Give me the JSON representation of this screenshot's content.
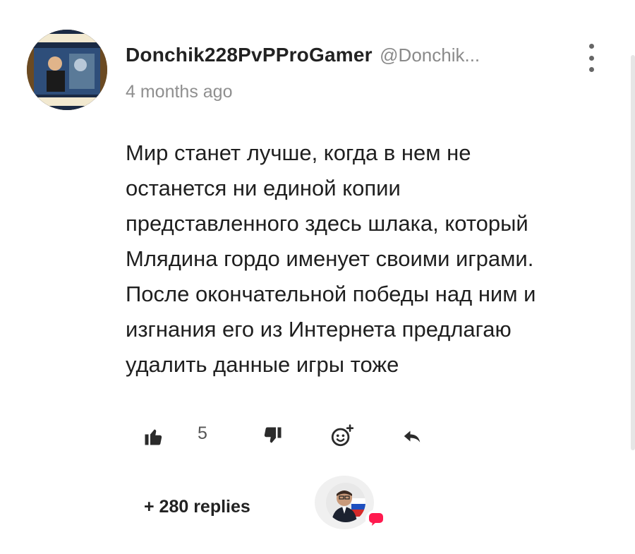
{
  "comment": {
    "author": {
      "display_name": "Donchik228PvPProGamer",
      "handle": "@Donchik...",
      "avatar_icon": "user-avatar-poster"
    },
    "timestamp": "4 months ago",
    "body_lines": [
      "Мир станет лучше, когда в нем не",
      "останется ни единой копии",
      "представленного здесь шлака, который",
      "Млядина гордо именует своими играми.",
      "После окончательной победы над ним и",
      "изгнания его из Интернета предлагаю",
      "удалить данные игры тоже"
    ],
    "actions": {
      "like_icon": "thumbs-up-icon",
      "like_count": "5",
      "dislike_icon": "thumbs-down-icon",
      "react_icon": "add-emoji-icon",
      "reply_icon": "reply-arrow-icon"
    },
    "replies": {
      "label": "+ 280 replies",
      "avatar_icon": "replier-avatar",
      "badge_icon": "chat-bubble-icon",
      "badge_color": "#ff1a4f"
    }
  },
  "colors": {
    "text_primary": "#1f1f1f",
    "text_secondary": "#8f8f8f",
    "icon": "#2b2b2b"
  }
}
